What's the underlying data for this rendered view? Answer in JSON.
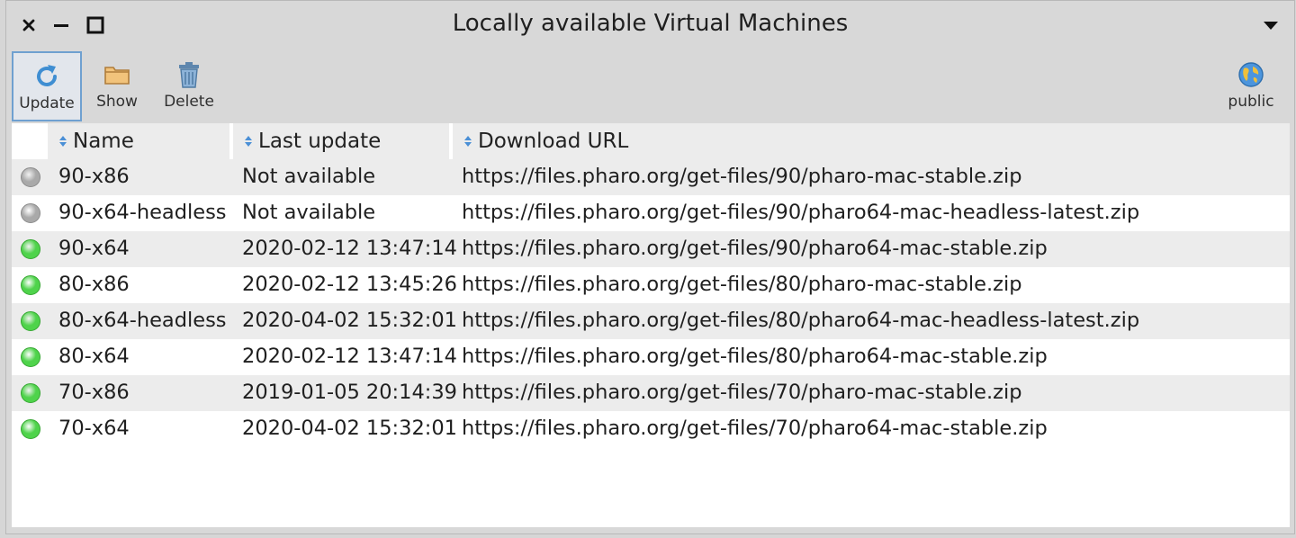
{
  "window": {
    "title": "Locally available Virtual Machines"
  },
  "toolbar": {
    "update_label": "Update",
    "show_label": "Show",
    "delete_label": "Delete",
    "public_label": "public"
  },
  "table": {
    "columns": [
      "Name",
      "Last update",
      "Download URL"
    ],
    "rows": [
      {
        "name": "90-x86",
        "last_update": "Not available",
        "url": "https://files.pharo.org/get-files/90/pharo-mac-stable.zip",
        "status": "grey"
      },
      {
        "name": "90-x64-headless",
        "last_update": "Not available",
        "url": "https://files.pharo.org/get-files/90/pharo64-mac-headless-latest.zip",
        "status": "grey"
      },
      {
        "name": "90-x64",
        "last_update": "2020-02-12 13:47:14",
        "url": "https://files.pharo.org/get-files/90/pharo64-mac-stable.zip",
        "status": "green"
      },
      {
        "name": "80-x86",
        "last_update": "2020-02-12 13:45:26",
        "url": "https://files.pharo.org/get-files/80/pharo-mac-stable.zip",
        "status": "green"
      },
      {
        "name": "80-x64-headless",
        "last_update": "2020-04-02 15:32:01",
        "url": "https://files.pharo.org/get-files/80/pharo64-mac-headless-latest.zip",
        "status": "green"
      },
      {
        "name": "80-x64",
        "last_update": "2020-02-12 13:47:14",
        "url": "https://files.pharo.org/get-files/80/pharo64-mac-stable.zip",
        "status": "green"
      },
      {
        "name": "70-x86",
        "last_update": "2019-01-05 20:14:39",
        "url": "https://files.pharo.org/get-files/70/pharo-mac-stable.zip",
        "status": "green"
      },
      {
        "name": "70-x64",
        "last_update": "2020-04-02 15:32:01",
        "url": "https://files.pharo.org/get-files/70/pharo64-mac-stable.zip",
        "status": "green"
      }
    ]
  },
  "colors": {
    "status_green": "#4fd34b",
    "status_grey": "#a9a9a9",
    "active_border": "#6fa0d0"
  },
  "icons": {
    "close": "close-icon",
    "minimize": "minimize-icon",
    "maximize": "maximize-icon",
    "menu": "window-menu-icon",
    "update": "refresh-icon",
    "show": "folder-icon",
    "delete": "trash-icon",
    "public": "globe-icon",
    "sort": "sort-arrows-icon"
  }
}
